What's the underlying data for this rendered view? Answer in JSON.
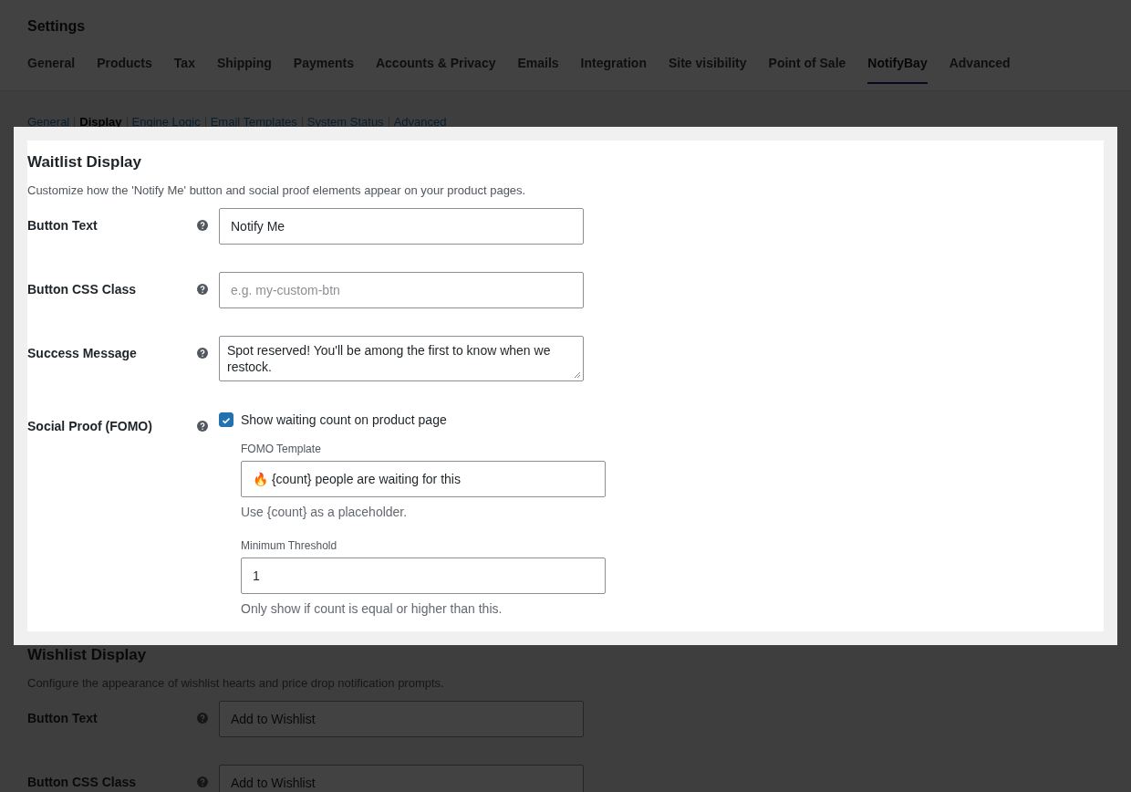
{
  "page_title": "Settings",
  "tabs": [
    {
      "label": "General",
      "selected": false
    },
    {
      "label": "Products",
      "selected": false
    },
    {
      "label": "Tax",
      "selected": false
    },
    {
      "label": "Shipping",
      "selected": false
    },
    {
      "label": "Payments",
      "selected": false
    },
    {
      "label": "Accounts & Privacy",
      "selected": false
    },
    {
      "label": "Emails",
      "selected": false
    },
    {
      "label": "Integration",
      "selected": false
    },
    {
      "label": "Site visibility",
      "selected": false
    },
    {
      "label": "Point of Sale",
      "selected": false
    },
    {
      "label": "NotifyBay",
      "selected": true
    },
    {
      "label": "Advanced",
      "selected": false
    }
  ],
  "subnav": [
    {
      "label": "General",
      "selected": false
    },
    {
      "label": "Display",
      "selected": true
    },
    {
      "label": "Engine Logic",
      "selected": false
    },
    {
      "label": "Email Templates",
      "selected": false
    },
    {
      "label": "System Status",
      "selected": false
    },
    {
      "label": "Advanced",
      "selected": false
    }
  ],
  "sections": [
    {
      "title": "Waitlist Display",
      "highlighted": true,
      "description": "Customize how the 'Notify Me' button and social proof elements appear on your product pages.",
      "fields": [
        {
          "kind": "text",
          "label": "Button Text",
          "value": "Notify Me"
        },
        {
          "kind": "text",
          "label": "Button CSS Class",
          "placeholder": "e.g. my-custom-btn"
        },
        {
          "kind": "textarea",
          "label": "Success Message",
          "value": "Spot reserved! You'll be among the first to know when we restock."
        },
        {
          "kind": "checkbox_group",
          "label": "Social Proof (FOMO)",
          "checkbox": {
            "label": "Show waiting count on product page",
            "checked": true
          },
          "subfields": [
            {
              "label": "FOMO Template",
              "value": "🔥 {count} people are waiting for this",
              "hint": "Use {count} as a placeholder."
            },
            {
              "label": "Minimum Threshold",
              "value": "1",
              "hint": "Only show if count is equal or higher than this."
            }
          ]
        }
      ]
    },
    {
      "title": "Wishlist Display",
      "highlighted": false,
      "description": "Configure the appearance of wishlist hearts and price drop notification prompts.",
      "fields": [
        {
          "kind": "text",
          "label": "Button Text",
          "value": "Add to Wishlist"
        },
        {
          "kind": "text",
          "label": "Button CSS Class",
          "value": "Add to Wishlist"
        }
      ]
    }
  ]
}
